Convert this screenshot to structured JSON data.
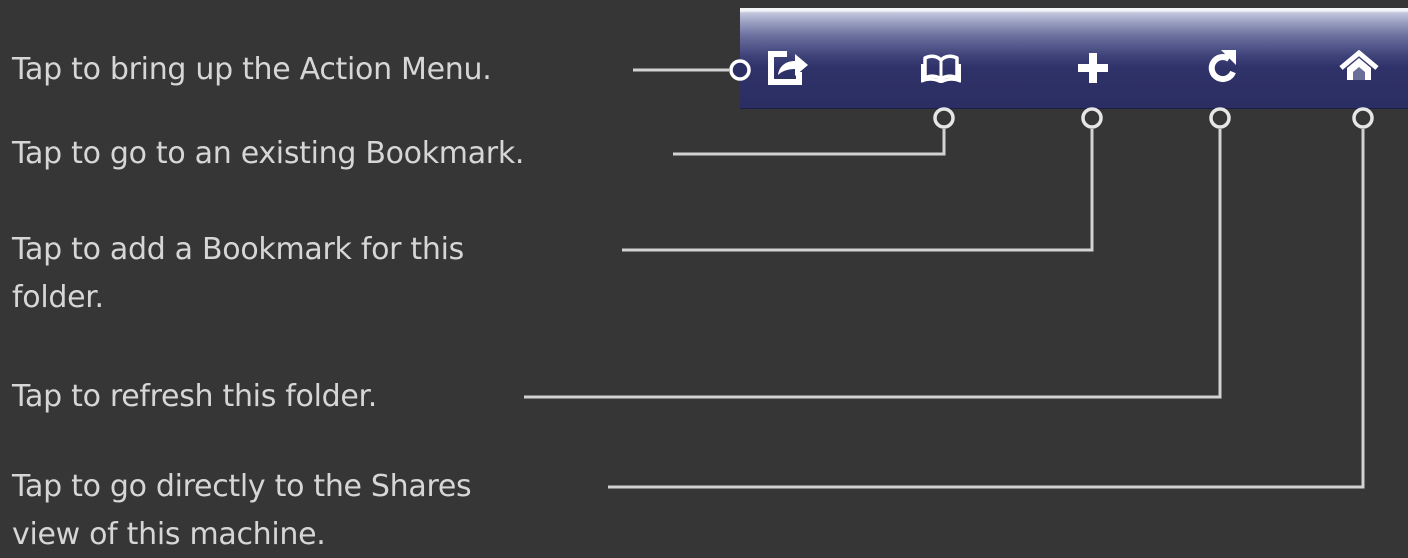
{
  "toolbar": {
    "buttons": [
      {
        "id": "action",
        "icon": "share-icon"
      },
      {
        "id": "bookmarks",
        "icon": "book-icon"
      },
      {
        "id": "add-bookmark",
        "icon": "plus-icon"
      },
      {
        "id": "refresh",
        "icon": "refresh-icon"
      },
      {
        "id": "home",
        "icon": "home-icon"
      }
    ],
    "colors": {
      "bar": "#2b2e62",
      "highlight": "#f4f5f9",
      "icon": "#ffffff"
    }
  },
  "callouts": [
    {
      "text": "Tap to bring up the Action Menu."
    },
    {
      "text": "Tap to go to an existing Bookmark."
    },
    {
      "line1": "Tap to add a Bookmark for this",
      "line2": "folder."
    },
    {
      "text": "Tap to refresh this folder."
    },
    {
      "line1": "Tap to go directly to the Shares",
      "line2": "view of this machine."
    }
  ],
  "colors": {
    "background": "#363636",
    "text": "#d6d6d6",
    "line": "#d2d2d2"
  }
}
